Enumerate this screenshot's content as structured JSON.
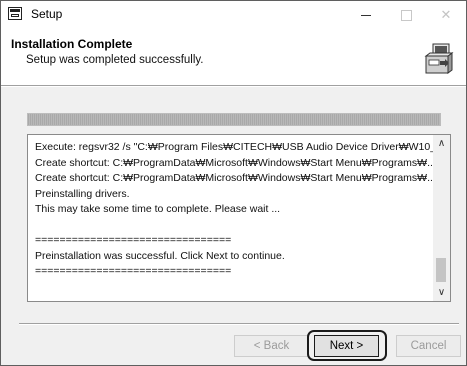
{
  "window": {
    "title": "Setup",
    "controls": {
      "minimize": "–",
      "maximize": "☐",
      "close": "✕"
    }
  },
  "header": {
    "title": "Installation Complete",
    "subtitle": "Setup was completed successfully.",
    "icon": "installer-box-icon"
  },
  "progress": {
    "value_percent": 100
  },
  "log": {
    "lines": [
      "Execute: regsvr32 /s \"C:₩Program Files₩CITECH₩USB Audio Device Driver₩W10_...",
      "Create shortcut: C:₩ProgramData₩Microsoft₩Windows₩Start Menu₩Programs₩...",
      "Create shortcut: C:₩ProgramData₩Microsoft₩Windows₩Start Menu₩Programs₩...",
      "Preinstalling drivers.",
      "This may take some time to complete. Please wait ...",
      "",
      "================================",
      "Preinstallation was successful. Click Next to continue.",
      "================================"
    ],
    "scroll_up": "∧",
    "scroll_down": "∨"
  },
  "buttons": {
    "back": "< Back",
    "next": "Next >",
    "cancel": "Cancel"
  }
}
